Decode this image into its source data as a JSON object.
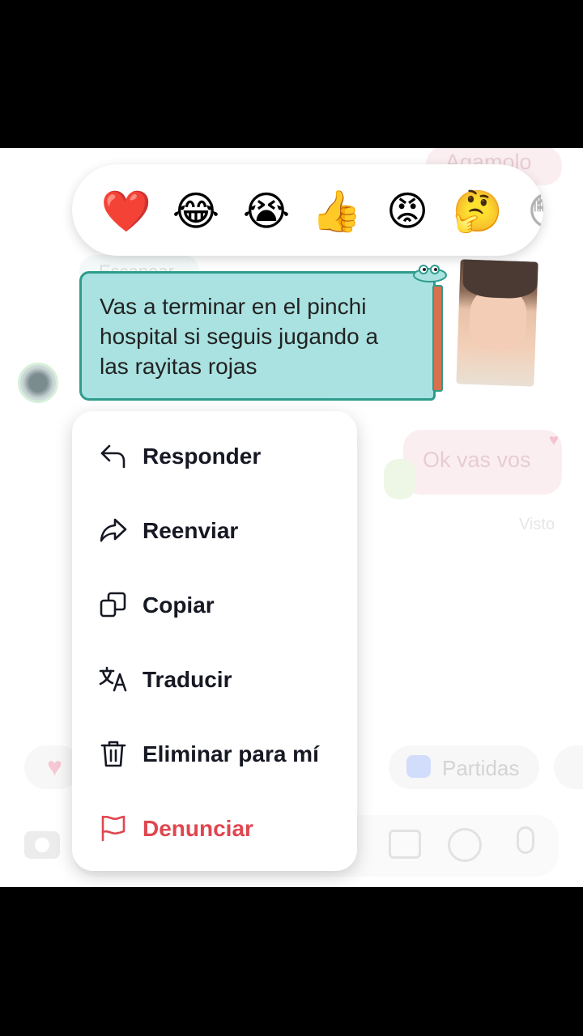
{
  "background_chat": {
    "top_message": "Agamolo",
    "left_message": "Escanear",
    "right_message": "Ok vas vos",
    "read_status": "Visto",
    "games_label": "Partidas"
  },
  "reactions": [
    {
      "name": "heart",
      "emoji": "❤️"
    },
    {
      "name": "laughing",
      "emoji": "😂"
    },
    {
      "name": "crying",
      "emoji": "😭"
    },
    {
      "name": "thumbs-up",
      "emoji": "👍"
    },
    {
      "name": "angry",
      "emoji": "😡"
    },
    {
      "name": "thinking",
      "emoji": "🤔"
    },
    {
      "name": "more",
      "emoji": "😳"
    }
  ],
  "message": {
    "text": "Vas a terminar en el pinchi\n hospital si seguis jugando a\nlas rayitas rojas"
  },
  "menu": {
    "items": [
      {
        "label": "Responder",
        "icon": "reply-icon"
      },
      {
        "label": "Reenviar",
        "icon": "forward-icon"
      },
      {
        "label": "Copiar",
        "icon": "copy-icon"
      },
      {
        "label": "Traducir",
        "icon": "translate-icon"
      },
      {
        "label": "Eliminar para mí",
        "icon": "trash-icon"
      },
      {
        "label": "Denunciar",
        "icon": "flag-icon"
      }
    ]
  },
  "colors": {
    "bubble": "#a9e2e0",
    "bubble_border": "#2f9c8c",
    "danger": "#e0464f",
    "text": "#161823"
  }
}
